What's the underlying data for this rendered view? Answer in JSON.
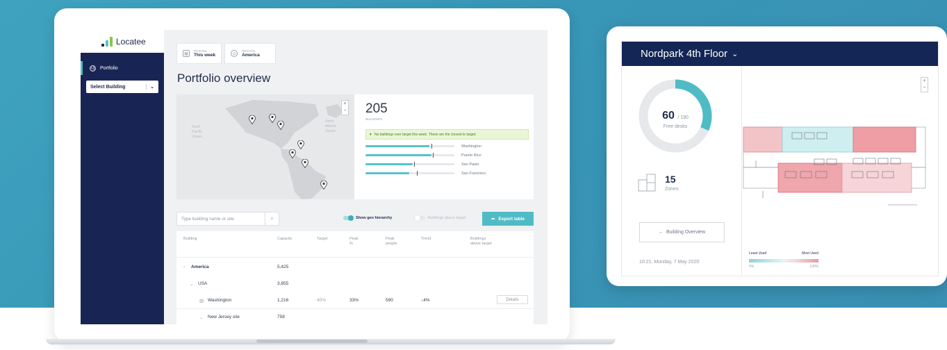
{
  "app": {
    "name": "Locatee"
  },
  "sidebar": {
    "portfolio_label": "Portfolio",
    "select_building_label": "Select Building"
  },
  "filters": [
    {
      "label": "PERIOD",
      "value": "This week"
    },
    {
      "label": "REGION",
      "value": "America"
    }
  ],
  "page_title": "Portfolio overview",
  "map_labels": {
    "ocean1": "North Pacific Ocean",
    "ocean2": "North Atlantic Ocean"
  },
  "stats": {
    "buildings_count": "205",
    "buildings_label": "BUILDINGS",
    "alert": "No buildings over target this week. These are the closest to target.",
    "bars": [
      {
        "name": "Washington",
        "fill": 0.72,
        "marker": 0.74
      },
      {
        "name": "Puerto Rico",
        "fill": 0.74,
        "marker": 0.76
      },
      {
        "name": "Sao Paulo",
        "fill": 0.53,
        "marker": 0.55
      },
      {
        "name": "San Francisco",
        "fill": 0.49,
        "marker": 0.58
      }
    ]
  },
  "tools": {
    "search_placeholder": "Type building name or site",
    "geo_toggle": "Show geo hierarchy",
    "above_toggle": "Buildings above target",
    "export_label": "Export table"
  },
  "table": {
    "columns": {
      "building": "Building",
      "capacity": "Capacity",
      "target": "Target",
      "peak_pct": "Peak",
      "peak_pct_sub": "%",
      "peak_people": "Peak",
      "peak_people_sub": "people",
      "trend": "Trend",
      "above": "Buildings",
      "above_sub": "above target"
    },
    "rows": [
      {
        "name": "America",
        "capacity": "5,425",
        "target": "",
        "peak_pct": "",
        "peak_people": "",
        "trend": ""
      },
      {
        "name": "USA",
        "capacity": "3,855",
        "target": "",
        "peak_pct": "",
        "peak_people": "",
        "trend": ""
      },
      {
        "name": "Washington",
        "capacity": "1,216",
        "target": "40%",
        "peak_pct": "33%",
        "peak_people": "590",
        "trend": "↓4%",
        "action": "Details"
      },
      {
        "name": "New Jersey site",
        "capacity": "758",
        "target": "",
        "peak_pct": "",
        "peak_people": "",
        "trend": ""
      }
    ]
  },
  "tablet": {
    "title": "Nordpark 4th Floor",
    "free_desks": "60",
    "total_desks": "/ 190",
    "free_desks_label": "Free desks",
    "free_fraction": 0.316,
    "zones": "15",
    "zones_label": "Zones",
    "overview_button": "Building Overview",
    "timestamp": "10:21, Monday, 7 May 2020",
    "legend_least": "Least Used",
    "legend_most": "Most Used",
    "legend_min": "0%",
    "legend_max": "100%"
  },
  "colors": {
    "navy": "#182554",
    "teal": "#4fbcc5",
    "accent_green": "#4e7a1e"
  }
}
